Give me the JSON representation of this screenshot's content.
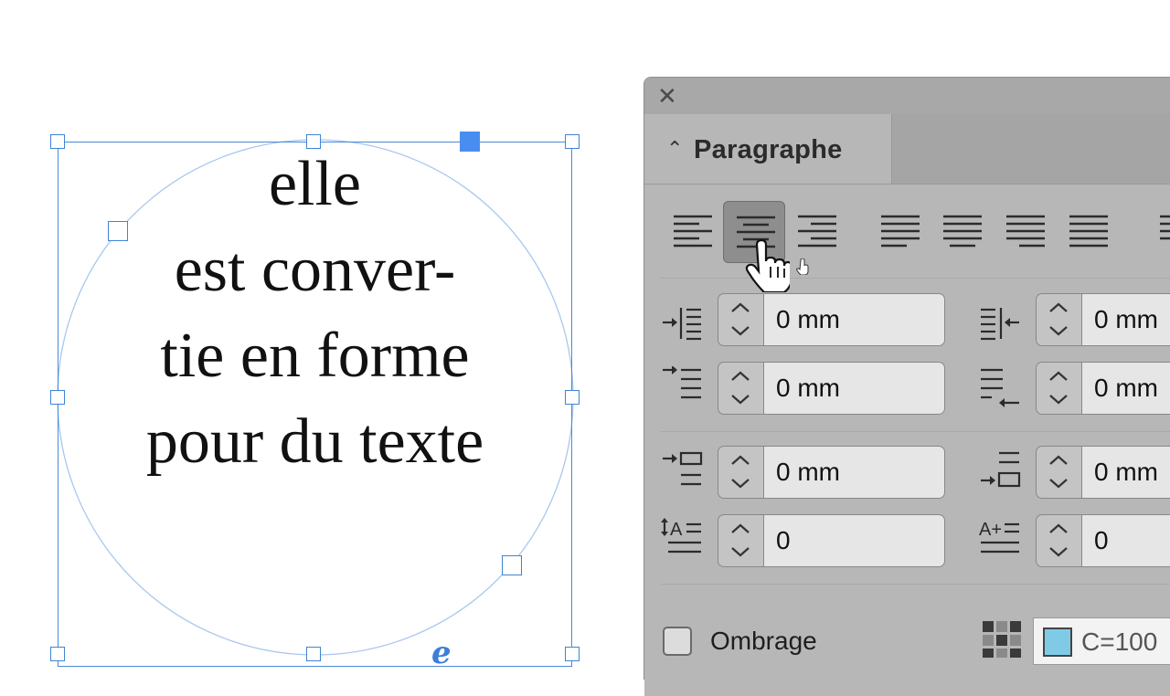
{
  "document": {
    "text_lines": [
      "elle",
      "est conver-",
      "tie en forme",
      "pour du texte"
    ],
    "overset_glyph": "e"
  },
  "panel": {
    "close_label": "✕",
    "tab_label": "Paragraphe",
    "alignment": {
      "buttons": [
        "align-left",
        "align-center",
        "align-right",
        "justify-left",
        "justify-center",
        "justify-right",
        "justify-all",
        "align-towards-spine"
      ],
      "active": "align-center"
    },
    "fields": {
      "left_indent": "0 mm",
      "right_indent": "0 mm",
      "first_line_indent": "0 mm",
      "last_line_indent": "0 mm",
      "space_before": "0 mm",
      "space_after": "0 mm",
      "drop_cap_lines": "0",
      "drop_cap_chars": "0"
    },
    "shading_label": "Ombrage",
    "shading_color_text": "C=100",
    "shading_color_hex": "#7fcbe6"
  }
}
